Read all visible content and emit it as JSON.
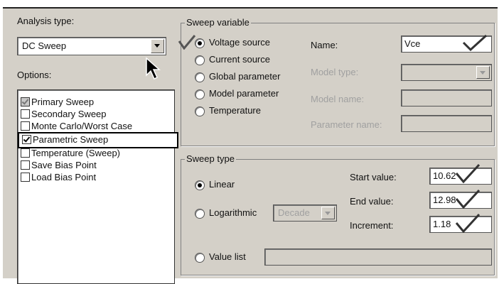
{
  "analysis_type": {
    "label": "Analysis type:",
    "value": "DC Sweep"
  },
  "options": {
    "label": "Options:",
    "items": [
      {
        "label": "Primary Sweep",
        "checked": true,
        "grayed": true
      },
      {
        "label": "Secondary Sweep",
        "checked": false
      },
      {
        "label": "Monte Carlo/Worst Case",
        "checked": false
      },
      {
        "label": "Parametric Sweep",
        "checked": true,
        "highlighted": true
      },
      {
        "label": "Temperature (Sweep)",
        "checked": false
      },
      {
        "label": "Save Bias Point",
        "checked": false
      },
      {
        "label": "Load Bias Point",
        "checked": false
      }
    ]
  },
  "sweep_variable": {
    "title": "Sweep variable",
    "radios": [
      {
        "label": "Voltage source",
        "selected": true
      },
      {
        "label": "Current source",
        "selected": false
      },
      {
        "label": "Global parameter",
        "selected": false
      },
      {
        "label": "Model parameter",
        "selected": false
      },
      {
        "label": "Temperature",
        "selected": false
      }
    ],
    "name_label": "Name:",
    "name_value": "Vce",
    "model_type_label": "Model type:",
    "model_name_label": "Model name:",
    "parameter_name_label": "Parameter name:"
  },
  "sweep_type": {
    "title": "Sweep type",
    "linear_label": "Linear",
    "log_label": "Logarithmic",
    "log_value": "Decade",
    "value_list_label": "Value list",
    "start_label": "Start value:",
    "start_value": "10.62",
    "end_label": "End value:",
    "end_value": "12.98",
    "increment_label": "Increment:",
    "increment_value": "1.18"
  }
}
